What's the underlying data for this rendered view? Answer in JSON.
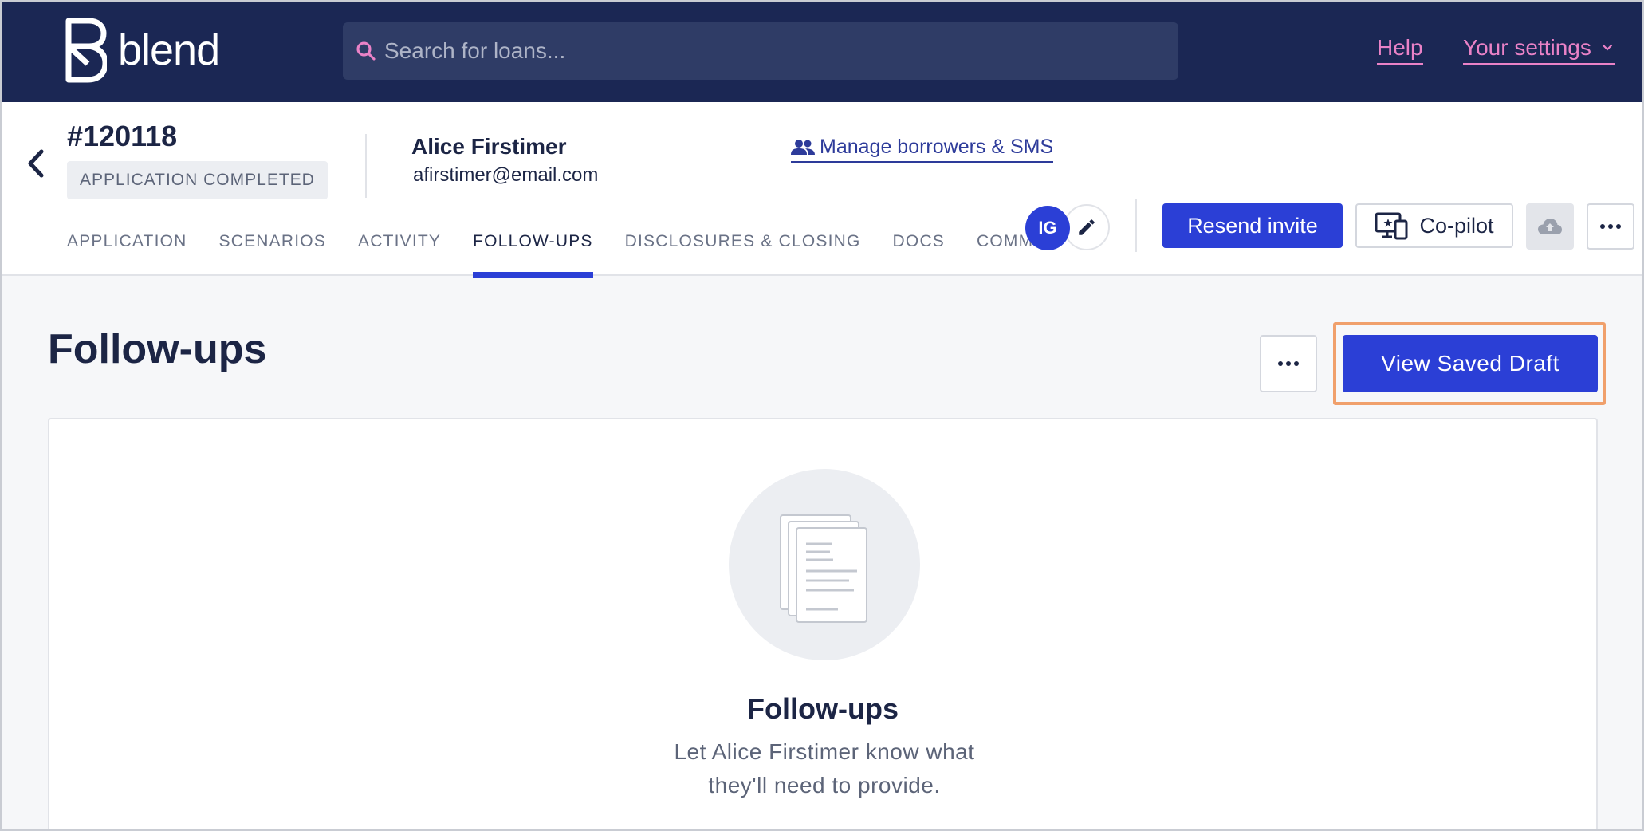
{
  "navbar": {
    "brand": "blend",
    "search_placeholder": "Search for loans...",
    "help_label": "Help",
    "settings_label": "Your settings",
    "bg_color": "#1b2754",
    "link_color": "#ea82c7"
  },
  "loan": {
    "number": "#120118",
    "status": "APPLICATION COMPLETED",
    "borrower_name": "Alice Firstimer",
    "borrower_email": "afirstimer@email.com",
    "manage_label": "Manage borrowers & SMS"
  },
  "tabs": [
    {
      "label": "APPLICATION",
      "active": false
    },
    {
      "label": "SCENARIOS",
      "active": false
    },
    {
      "label": "ACTIVITY",
      "active": false
    },
    {
      "label": "FOLLOW-UPS",
      "active": true
    },
    {
      "label": "DISCLOSURES & CLOSING",
      "active": false
    },
    {
      "label": "DOCS",
      "active": false
    },
    {
      "label": "COMMS",
      "active": false
    }
  ],
  "actions": {
    "avatar_initials": "IG",
    "resend_label": "Resend invite",
    "copilot_label": "Co-pilot",
    "accent_color": "#2b3fd6"
  },
  "main": {
    "title": "Follow-ups",
    "view_draft_label": "View Saved Draft",
    "empty_title": "Follow-ups",
    "empty_desc": "Let Alice Firstimer know what they'll need to provide.",
    "highlight_color": "#f0a06c"
  }
}
